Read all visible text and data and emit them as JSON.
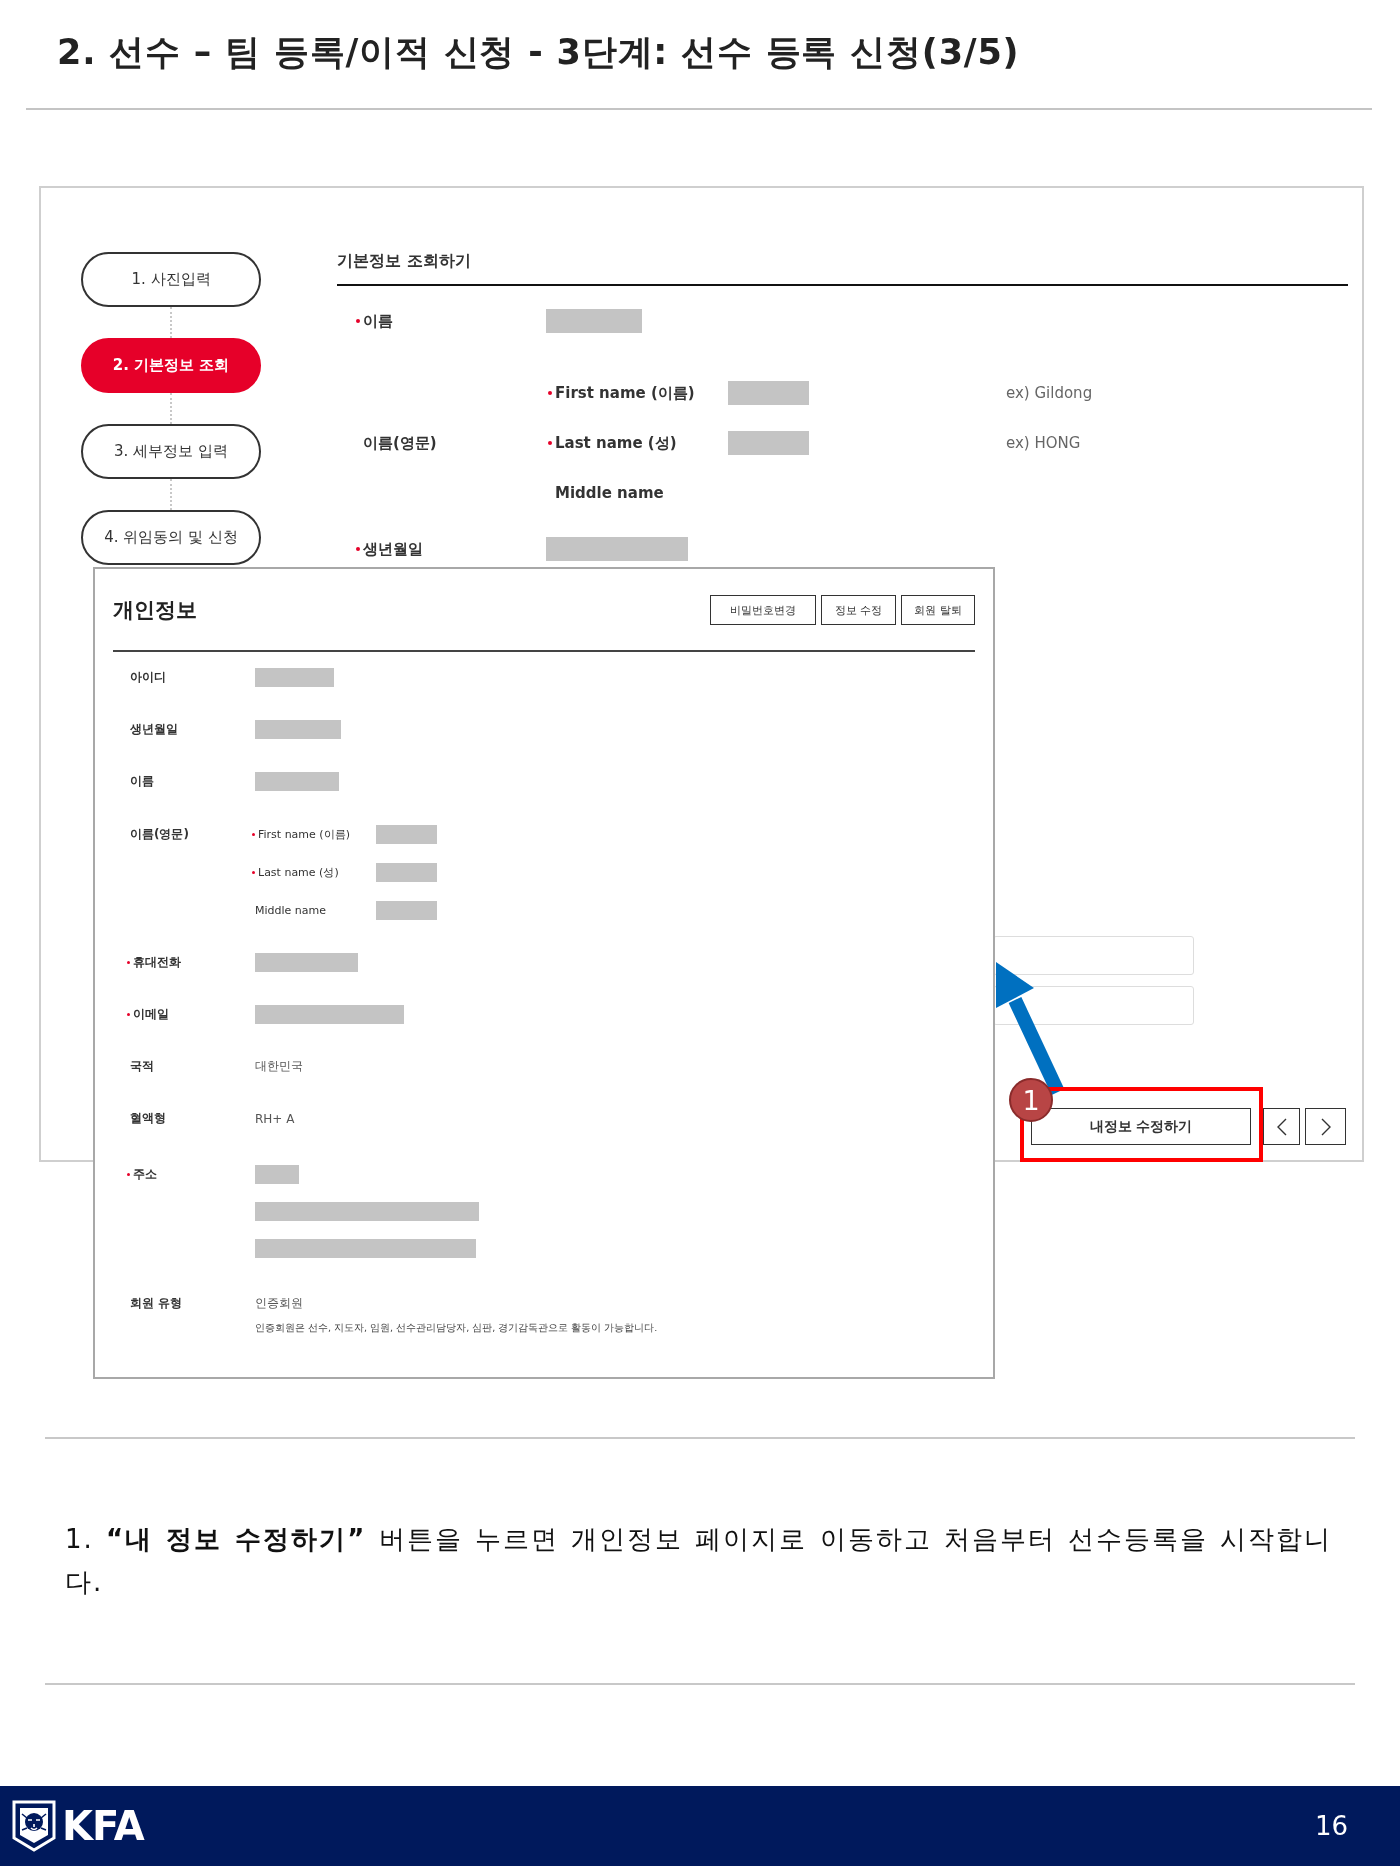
{
  "slide": {
    "title": "2. 선수 – 팀 등록/이적 신청 - 3단계: 선수 등록 신청(3/5)"
  },
  "steps": [
    {
      "label": "1. 사진입력",
      "selected": false
    },
    {
      "label": "2. 기본정보 조회",
      "selected": true
    },
    {
      "label": "3. 세부정보 입력",
      "selected": false
    },
    {
      "label": "4. 위임동의 및 신청",
      "selected": false
    }
  ],
  "basic_info": {
    "heading": "기본정보 조회하기",
    "rows": [
      {
        "kind": "single",
        "label": "이름",
        "required": true,
        "values": [
          {
            "kind": "redacted"
          }
        ]
      },
      {
        "kind": "group",
        "label": "이름(영문)",
        "required": false,
        "subrows": [
          {
            "label": "First name (이름)",
            "required": true,
            "values": [
              {
                "kind": "redacted"
              }
            ],
            "hint": "ex) Gildong"
          },
          {
            "label": "Last name (성)",
            "required": true,
            "values": [
              {
                "kind": "redacted"
              }
            ],
            "hint": "ex) HONG"
          },
          {
            "label": "Middle name",
            "required": false,
            "values": []
          }
        ]
      },
      {
        "kind": "single",
        "label": "생년월일",
        "required": true,
        "values": [
          {
            "kind": "redacted"
          }
        ]
      }
    ],
    "fields": [
      {
        "kind": "text-input"
      },
      {
        "kind": "text-input"
      }
    ],
    "buttons": [
      {
        "kind": "text",
        "label": "내정보 수정하기"
      },
      {
        "kind": "previous"
      },
      {
        "kind": "next"
      }
    ]
  },
  "profile_panel": {
    "title": "개인정보",
    "buttons": [
      "비밀번호변경",
      "정보 수정",
      "회원 탈퇴"
    ],
    "rows": [
      {
        "kind": "single",
        "label": "아이디",
        "required": false,
        "values": [
          {
            "kind": "redacted"
          }
        ]
      },
      {
        "kind": "single",
        "label": "생년월일",
        "required": false,
        "values": [
          {
            "kind": "redacted"
          }
        ]
      },
      {
        "kind": "single",
        "label": "이름",
        "required": false,
        "values": [
          {
            "kind": "redacted"
          }
        ]
      },
      {
        "kind": "group",
        "label": "이름(영문)",
        "required": false,
        "subrows": [
          {
            "label": "First name (이름)",
            "required": true,
            "values": [
              {
                "kind": "redacted"
              }
            ]
          },
          {
            "label": "Last name (성)",
            "required": true,
            "values": [
              {
                "kind": "redacted"
              }
            ]
          },
          {
            "label": "Middle name",
            "required": false,
            "values": [
              {
                "kind": "redacted"
              }
            ]
          }
        ]
      },
      {
        "kind": "single",
        "label": "휴대전화",
        "required": true,
        "values": [
          {
            "kind": "redacted"
          }
        ]
      },
      {
        "kind": "single",
        "label": "이메일",
        "required": true,
        "values": [
          {
            "kind": "redacted"
          }
        ]
      },
      {
        "kind": "single",
        "label": "국적",
        "required": false,
        "values": [
          {
            "kind": "text",
            "text": "대한민국"
          }
        ]
      },
      {
        "kind": "single",
        "label": "혈액형",
        "required": false,
        "values": [
          {
            "kind": "text",
            "text": "RH+ A"
          }
        ]
      },
      {
        "kind": "multi",
        "label": "주소",
        "required": true,
        "values": [
          {
            "kind": "redacted"
          },
          {
            "kind": "redacted"
          },
          {
            "kind": "redacted"
          }
        ]
      },
      {
        "kind": "multi",
        "label": "회원 유형",
        "required": false,
        "values": [
          {
            "kind": "text",
            "text": "인증회원"
          },
          {
            "kind": "note",
            "text": "인증회원은 선수, 지도자, 임원, 선수관리담당자, 심판, 경기감독관으로 활동이 가능합니다."
          }
        ]
      }
    ]
  },
  "callout": {
    "number": "1"
  },
  "description": "1. **“내 정보 수정하기”** 버튼을 누르면 개인정보 페이지로 이동하고 처음부터 선수등록을 시작합니다.",
  "footer": {
    "logo_text": "KFA",
    "page_number": "16"
  }
}
